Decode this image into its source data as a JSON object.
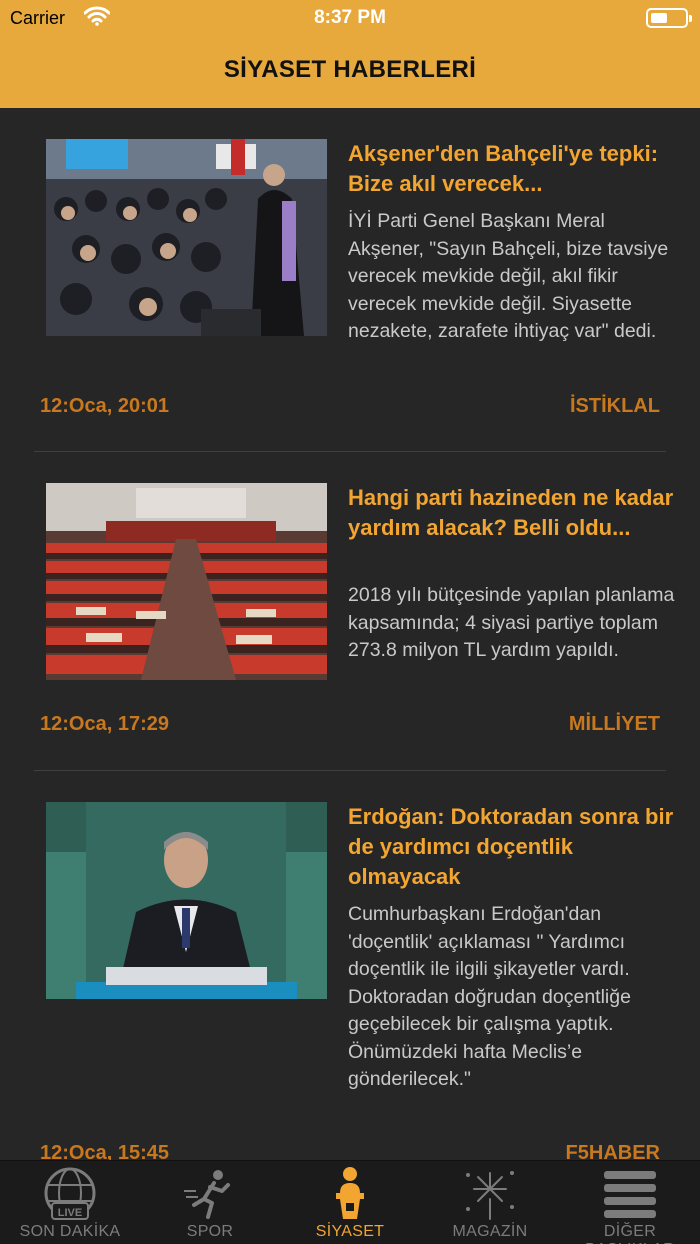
{
  "status_bar": {
    "carrier": "Carrier",
    "time": "8:37 PM"
  },
  "header": {
    "title": "SİYASET HABERLERİ",
    "background": "#E8A93C"
  },
  "colors": {
    "accent": "#F2A531",
    "meta": "#C8781E",
    "background": "#262626",
    "body_text": "#C9C9C9"
  },
  "articles": [
    {
      "headline": "Akşener'den Bahçeli'ye tepki: Bize akıl verecek...",
      "summary": "İYİ Parti Genel Başkanı Meral Akşener, \"Sayın Bahçeli, bize tavsiye verecek mevkide değil, akıl fikir verecek mevkide değil. Siyasette nezakete, zarafete ihtiyaç var\" dedi.",
      "time": "12:Oca, 20:01",
      "source": "İSTİKLAL",
      "image": "rally-crowd-photo"
    },
    {
      "headline": "Hangi parti hazineden ne kadar yardım alacak? Belli oldu...",
      "summary": "2018 yılı bütçesinde yapılan planlama kapsamında; 4 siyasi partiye toplam 273.8 milyon TL yardım yapıldı.",
      "time": "12:Oca, 17:29",
      "source": "MİLLİYET",
      "image": "parliament-hall-photo"
    },
    {
      "headline": "Erdoğan: Doktoradan sonra bir de yardımcı doçentlik olmayacak",
      "summary": "Cumhurbaşkanı Erdoğan'dan 'doçentlik' açıklaması \" Yardımcı doçentlik ile ilgili şikayetler vardı. Doktoradan doğrudan doçentliğe geçebilecek bir çalışma yaptık. Önümüzdeki hafta Meclis’e gönderilecek.\"",
      "time": "12:Oca, 15:45",
      "source": "F5HABER",
      "image": "speaker-podium-photo"
    }
  ],
  "tabs": [
    {
      "label": "SON DAKİKA",
      "icon": "live-globe-icon",
      "active": false
    },
    {
      "label": "SPOR",
      "icon": "runner-icon",
      "active": false
    },
    {
      "label": "SİYASET",
      "icon": "podium-speaker-icon",
      "active": true
    },
    {
      "label": "MAGAZİN",
      "icon": "fireworks-icon",
      "active": false
    },
    {
      "label": "DİĞER BAŞLIKLAR",
      "icon": "list-icon",
      "active": false
    }
  ]
}
